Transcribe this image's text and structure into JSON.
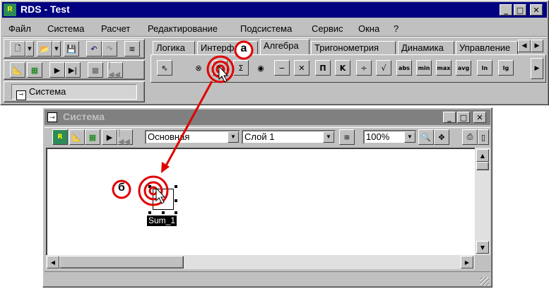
{
  "main_window": {
    "title": "RDS - Test",
    "menu": [
      "Файл",
      "Система",
      "Расчет",
      "Редактирование",
      "Подсистема",
      "Сервис",
      "Окна",
      "?"
    ],
    "tabs": [
      "Логика",
      "Интерфейс",
      "Алгебра",
      "Тригонометрия",
      "Динамика",
      "Управление"
    ],
    "active_tab": "Алгебра",
    "palette_small_labels": [
      "abs",
      "min",
      "max",
      "avg",
      "ln",
      "lg"
    ],
    "system_button_label": "Система"
  },
  "system_window": {
    "title": "Система",
    "layer_combo_value": "Основная",
    "sublayer_combo_value": "Слой 1",
    "zoom_combo_value": "100%",
    "block_label": "Sum_1"
  },
  "annotations": {
    "marker_a": "а",
    "marker_b": "б",
    "accent_color": "#e00000"
  },
  "colors": {
    "title_active": "#000080",
    "title_inactive": "#808080",
    "face": "#c0c0c0"
  }
}
